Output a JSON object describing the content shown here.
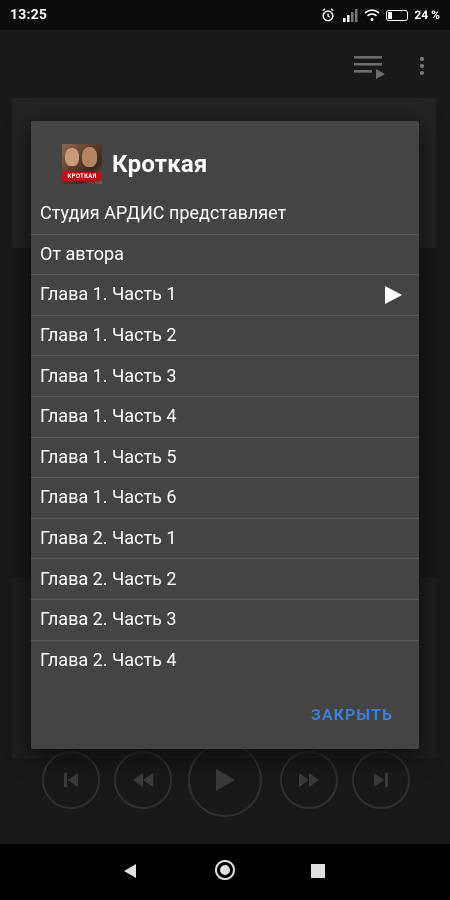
{
  "status_bar": {
    "time": "13:25",
    "battery_percent": "24 %",
    "icons": [
      "alarm-icon",
      "signal-icon",
      "wifi-icon",
      "battery-icon"
    ]
  },
  "dialog": {
    "title": "Кроткая",
    "cover_text": "КРОТКАЯ",
    "items": [
      {
        "label": "Студия АРДИС представляет",
        "playing": false
      },
      {
        "label": "От автора",
        "playing": false
      },
      {
        "label": "Глава 1. Часть 1",
        "playing": true
      },
      {
        "label": "Глава 1. Часть 2",
        "playing": false
      },
      {
        "label": "Глава 1. Часть 3",
        "playing": false
      },
      {
        "label": "Глава 1. Часть 4",
        "playing": false
      },
      {
        "label": "Глава 1. Часть 5",
        "playing": false
      },
      {
        "label": "Глава 1. Часть 6",
        "playing": false
      },
      {
        "label": "Глава 2. Часть 1",
        "playing": false
      },
      {
        "label": "Глава 2. Часть 2",
        "playing": false
      },
      {
        "label": "Глава 2. Часть 3",
        "playing": false
      },
      {
        "label": "Глава 2. Часть 4",
        "playing": false
      }
    ],
    "close_label": "ЗАКРЫТЬ"
  },
  "colors": {
    "accent": "#3b7fd6",
    "dialog_bg": "#444444",
    "app_bg": "#191919"
  }
}
